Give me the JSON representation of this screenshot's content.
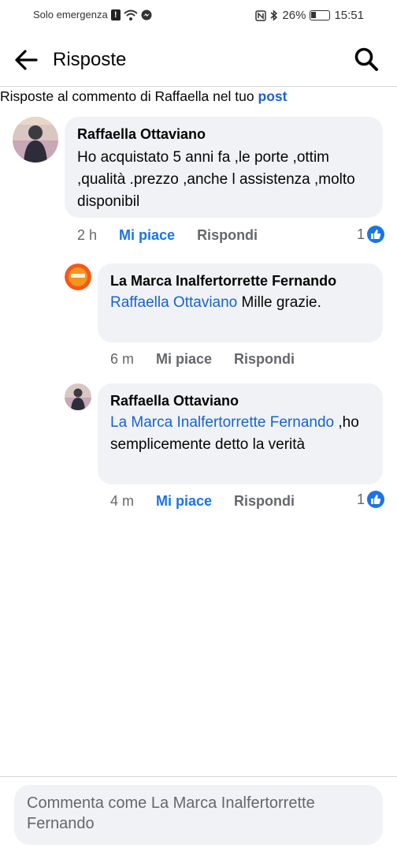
{
  "status_bar": {
    "carrier": "Solo emergenza",
    "battery": "26%",
    "time": "15:51"
  },
  "header": {
    "title": "Risposte"
  },
  "context": {
    "prefix": "Risposte al commento di Raffaella nel tuo ",
    "link": "post"
  },
  "comments": [
    {
      "author": "Raffaella Ottaviano",
      "text": "Ho acquistato  5 anni fa ,le porte ,ottim ,qualità  .prezzo ,anche l assistenza  ,molto disponibil",
      "time": "2 h",
      "like_label": "Mi piace",
      "reply_label": "Rispondi",
      "reactions": "1",
      "liked": true
    },
    {
      "author": "La Marca Inalfertorrette Fernando",
      "mention": "Raffaella Ottaviano",
      "text": " Mille grazie.",
      "time": "6 m",
      "like_label": "Mi piace",
      "reply_label": "Rispondi",
      "liked": false
    },
    {
      "author": "Raffaella Ottaviano",
      "mention": "La Marca Inalfertorrette Fernando",
      "text": " ,ho  semplicemente detto la verità",
      "time": "4 m",
      "like_label": "Mi piace",
      "reply_label": "Rispondi",
      "reactions": "1",
      "liked": true
    }
  ],
  "composer": {
    "placeholder": "Commenta come La Marca Inalfertorrette Fernando"
  },
  "colors": {
    "accent": "#1b74e4",
    "mention": "#1763cf",
    "bubble": "#f0f2f5",
    "muted": "#65676b"
  }
}
